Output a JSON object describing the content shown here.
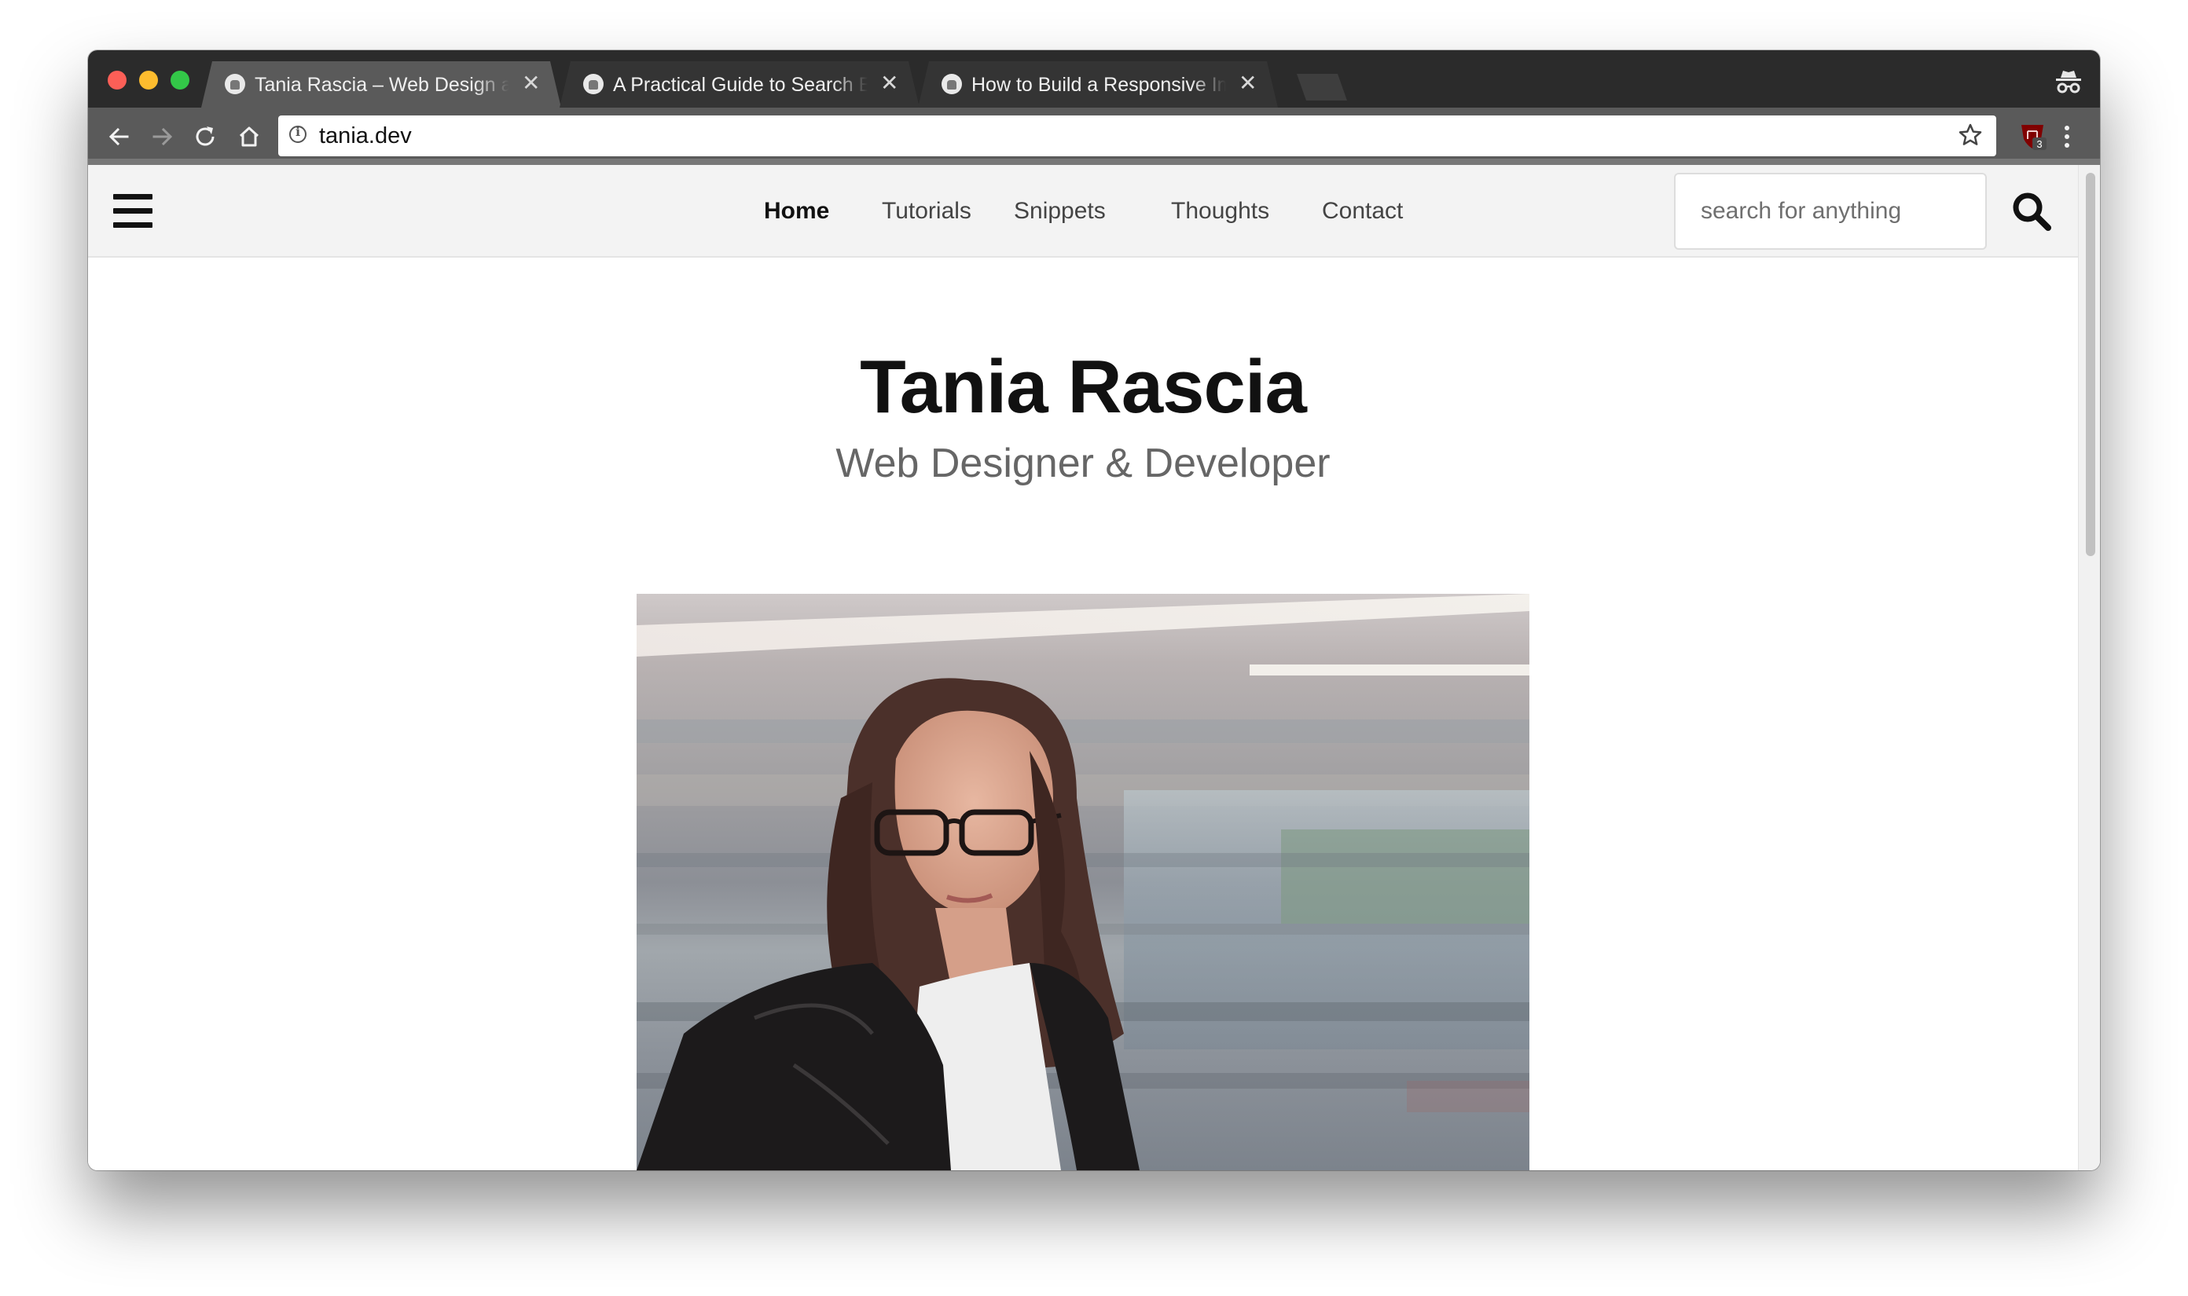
{
  "browser": {
    "tabs": [
      {
        "title": "Tania Rascia – Web Design and Development",
        "active": true
      },
      {
        "title": "A Practical Guide to Search Engine Optimization",
        "active": false
      },
      {
        "title": "How to Build a Responsive Image Gallery",
        "active": false
      }
    ],
    "close_glyph": "✕",
    "url": "tania.dev",
    "extension_badge_count": "3",
    "icons": {
      "back": "arrow-left-icon",
      "forward": "arrow-right-icon",
      "reload": "reload-icon",
      "home": "home-icon",
      "info": "info-icon",
      "bookmark": "star-icon",
      "extension": "shield-icon",
      "menu": "kebab-menu-icon",
      "incognito": "incognito-icon"
    }
  },
  "site": {
    "nav": {
      "links": [
        {
          "label": "Home",
          "active": true
        },
        {
          "label": "Tutorials",
          "active": false
        },
        {
          "label": "Snippets",
          "active": false
        },
        {
          "label": "Thoughts",
          "active": false
        },
        {
          "label": "Contact",
          "active": false
        }
      ],
      "search_placeholder": "search for anything"
    },
    "hero": {
      "title": "Tania Rascia",
      "subtitle": "Web Designer & Developer"
    },
    "colors": {
      "text_dark": "#111111",
      "subtitle_gray": "#666666",
      "nav_background": "#f3f3f3"
    }
  }
}
